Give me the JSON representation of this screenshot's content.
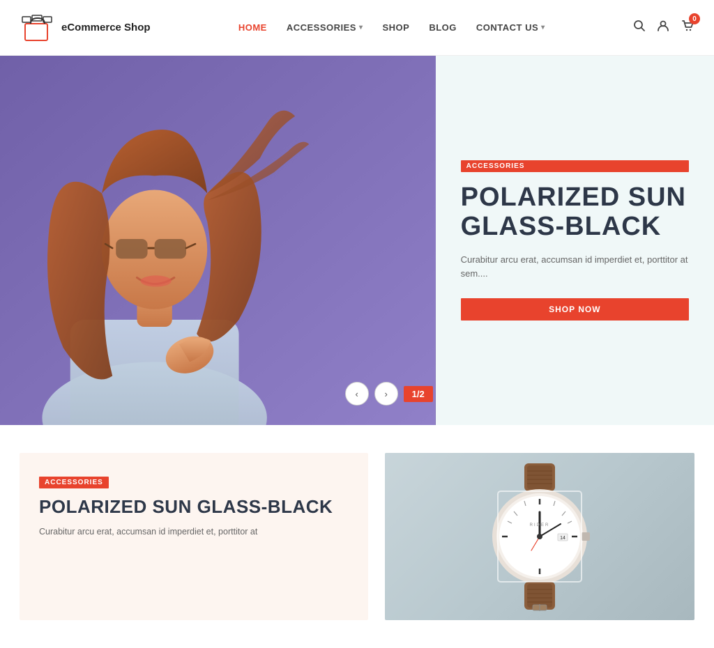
{
  "header": {
    "logo_text": "eCommerce Shop",
    "nav_items": [
      {
        "label": "HOME",
        "active": true,
        "has_dropdown": false
      },
      {
        "label": "ACCESSORIES",
        "active": false,
        "has_dropdown": true
      },
      {
        "label": "SHOP",
        "active": false,
        "has_dropdown": false
      },
      {
        "label": "BLOG",
        "active": false,
        "has_dropdown": false
      },
      {
        "label": "CONTACT US",
        "active": false,
        "has_dropdown": true
      }
    ],
    "cart_count": "0"
  },
  "hero": {
    "category_badge": "ACCESSORIES",
    "title": "POLARIZED SUN GLASS-BLACK",
    "description": "Curabitur arcu erat, accumsan id imperdiet et, porttitor at sem....",
    "cta_label": "SHOP NOW",
    "slide_current": "1",
    "slide_total": "2"
  },
  "product_card_1": {
    "category_badge": "ACCESSORIES",
    "title": "POLARIZED SUN GLASS-BLACK",
    "description": "Curabitur arcu erat, accumsan id imperdiet et, porttitor at"
  },
  "product_card_2": {
    "type": "watch_image"
  },
  "nav_prev_label": "‹",
  "nav_next_label": "›"
}
